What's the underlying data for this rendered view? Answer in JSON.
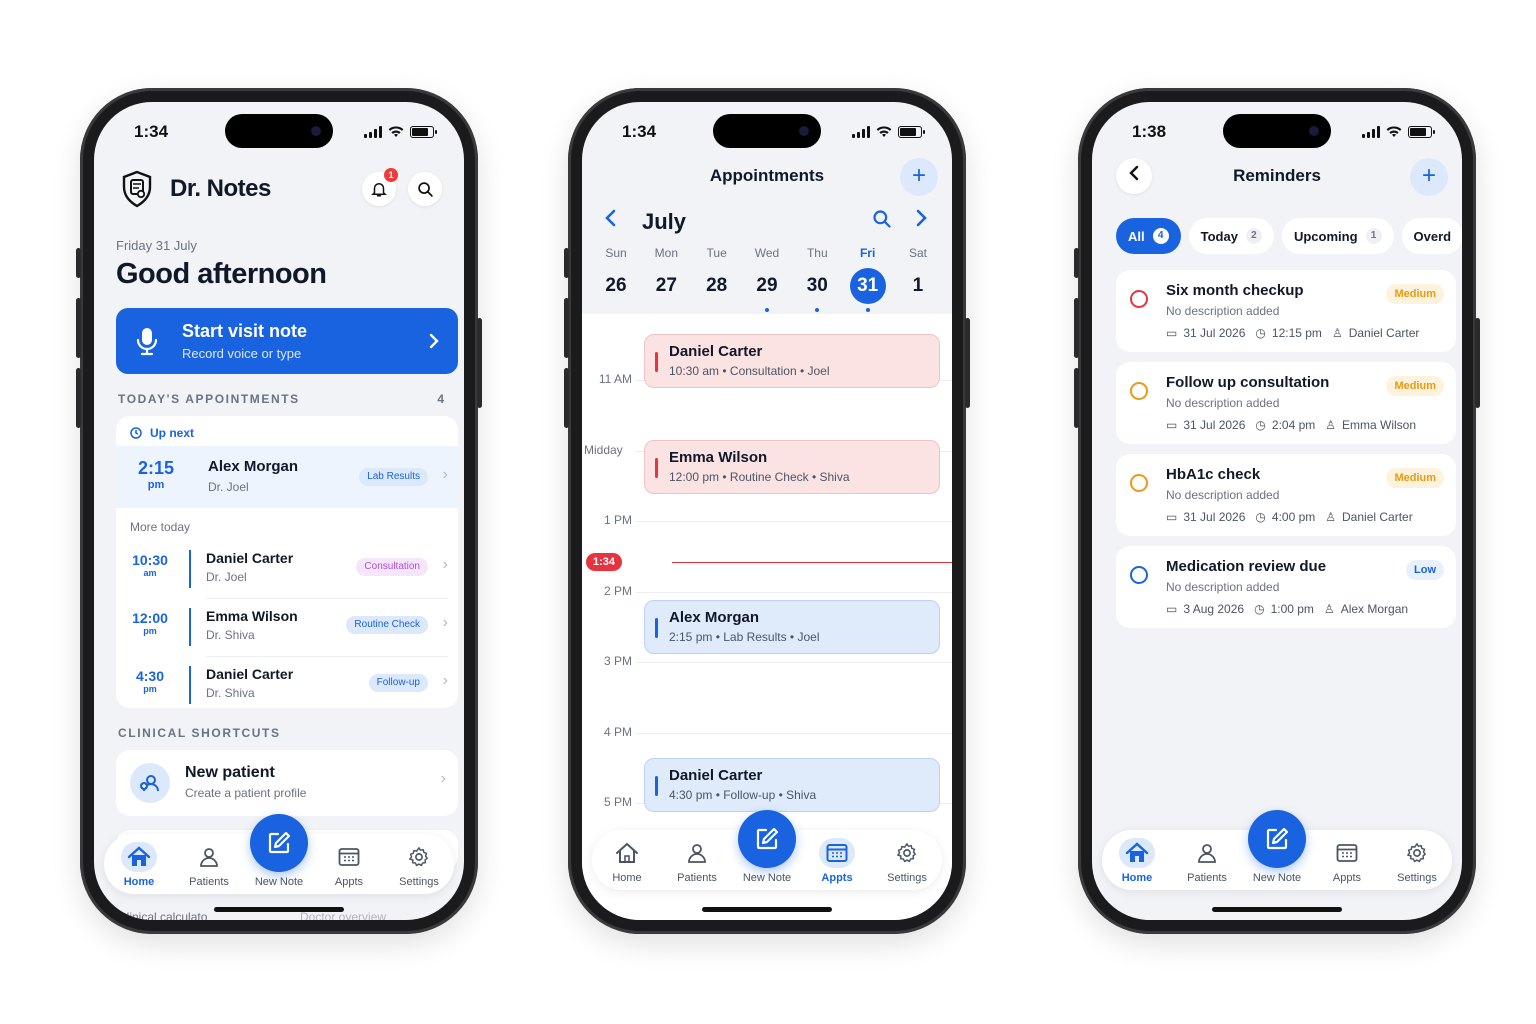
{
  "status": {
    "time_1": "1:34",
    "time_2": "1:34",
    "time_3": "1:38"
  },
  "home": {
    "app_name": "Dr. Notes",
    "notification_count": "1",
    "date": "Friday 31 July",
    "greeting": "Good afternoon",
    "cta_title": "Start visit note",
    "cta_subtitle": "Record voice or type",
    "section_appointments": "TODAY'S APPOINTMENTS",
    "appointments_count": "4",
    "up_next_label": "Up next",
    "more_today_label": "More today",
    "next_appt": {
      "time": "2:15",
      "ampm": "pm",
      "patient": "Alex Morgan",
      "doctor": "Dr. Joel",
      "tag": "Lab Results"
    },
    "appts": [
      {
        "time": "10:30",
        "ampm": "am",
        "patient": "Daniel Carter",
        "doctor": "Dr. Joel",
        "tag": "Consultation"
      },
      {
        "time": "12:00",
        "ampm": "pm",
        "patient": "Emma Wilson",
        "doctor": "Dr. Shiva",
        "tag": "Routine Check"
      },
      {
        "time": "4:30",
        "ampm": "pm",
        "patient": "Daniel Carter",
        "doctor": "Dr. Shiva",
        "tag": "Follow-up"
      }
    ],
    "section_shortcuts": "CLINICAL SHORTCUTS",
    "shortcut_title": "New patient",
    "shortcut_subtitle": "Create a patient profile",
    "under_left": "Clinical calculato",
    "under_right": "Doctor overview"
  },
  "tabs": {
    "home": "Home",
    "patients": "Patients",
    "new_note": "New Note",
    "appts": "Appts",
    "settings": "Settings"
  },
  "calendar": {
    "title": "Appointments",
    "month": "July",
    "days": [
      {
        "name": "Sun",
        "num": "26"
      },
      {
        "name": "Mon",
        "num": "27"
      },
      {
        "name": "Tue",
        "num": "28"
      },
      {
        "name": "Wed",
        "num": "29"
      },
      {
        "name": "Thu",
        "num": "30"
      },
      {
        "name": "Fri",
        "num": "31"
      },
      {
        "name": "Sat",
        "num": "1"
      }
    ],
    "hours": [
      "11 AM",
      "Midday",
      "1 PM",
      "2 PM",
      "3 PM",
      "4 PM",
      "5 PM"
    ],
    "now_label": "1:34",
    "events": [
      {
        "patient": "Daniel Carter",
        "detail": "10:30 am • Consultation • Joel"
      },
      {
        "patient": "Emma Wilson",
        "detail": "12:00 pm • Routine Check • Shiva"
      },
      {
        "patient": "Alex Morgan",
        "detail": "2:15 pm • Lab Results • Joel"
      },
      {
        "patient": "Daniel Carter",
        "detail": "4:30 pm • Follow-up • Shiva"
      }
    ]
  },
  "reminders": {
    "title": "Reminders",
    "filters": [
      {
        "label": "All",
        "count": "4"
      },
      {
        "label": "Today",
        "count": "2"
      },
      {
        "label": "Upcoming",
        "count": "1"
      },
      {
        "label": "Overd",
        "count": ""
      }
    ],
    "items": [
      {
        "title": "Six month checkup",
        "desc": "No description added",
        "date": "31 Jul 2026",
        "time": "12:15 pm",
        "patient": "Daniel Carter",
        "priority": "Medium"
      },
      {
        "title": "Follow up consultation",
        "desc": "No description added",
        "date": "31 Jul 2026",
        "time": "2:04 pm",
        "patient": "Emma Wilson",
        "priority": "Medium"
      },
      {
        "title": "HbA1c check",
        "desc": "No description added",
        "date": "31 Jul 2026",
        "time": "4:00 pm",
        "patient": "Daniel Carter",
        "priority": "Medium"
      },
      {
        "title": "Medication review due",
        "desc": "No description added",
        "date": "3 Aug 2026",
        "time": "1:00 pm",
        "patient": "Alex Morgan",
        "priority": "Low"
      }
    ]
  },
  "colors": {
    "accent": "#1a63e0",
    "danger": "#e5343f",
    "medium": "#e99a16"
  }
}
